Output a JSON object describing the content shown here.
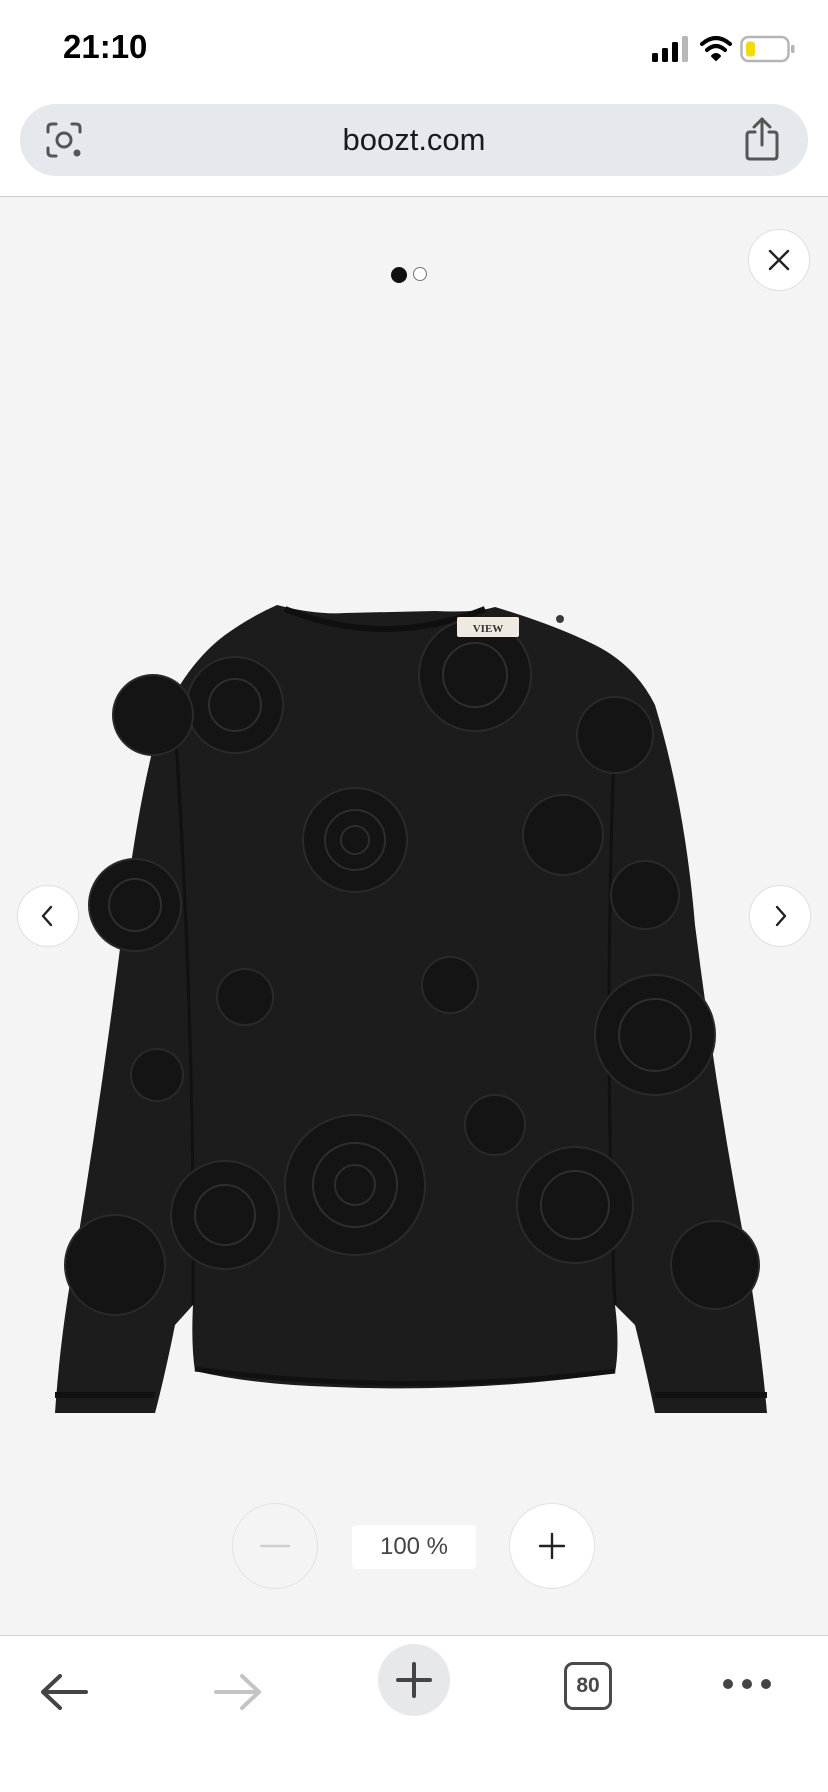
{
  "status_bar": {
    "time": "21:10",
    "icons": [
      "signal-icon",
      "wifi-icon",
      "battery-icon"
    ],
    "battery_color": "#f5d90a"
  },
  "browser": {
    "url": "boozt.com",
    "icons": [
      "lens-icon",
      "share-icon"
    ]
  },
  "viewer": {
    "image_count": 2,
    "active_index": 0,
    "label_brand": "VIEW",
    "zoom_level": "100 %",
    "icons": [
      "close-icon",
      "chevron-left-icon",
      "chevron-right-icon",
      "minus-icon",
      "plus-icon"
    ]
  },
  "toolbar": {
    "tab_count": "80",
    "icons": [
      "back-arrow-icon",
      "forward-arrow-icon",
      "plus-icon",
      "tabs-icon",
      "more-icon"
    ]
  }
}
